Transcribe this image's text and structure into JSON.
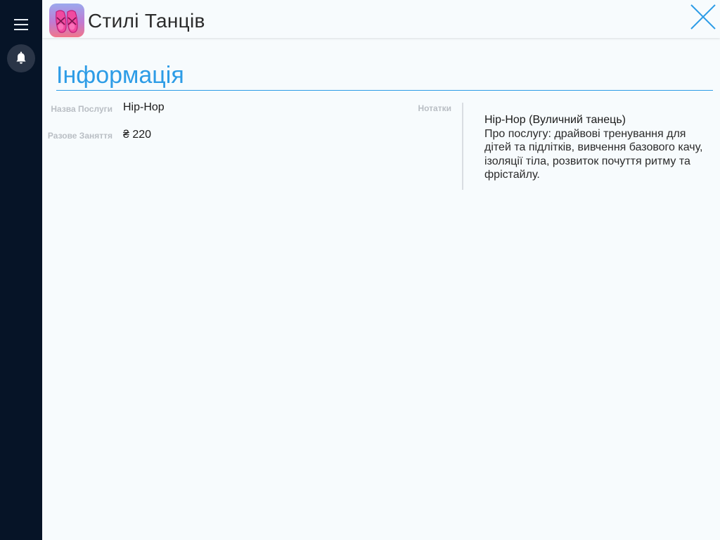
{
  "app": {
    "title": "Стилі Танців",
    "icon": "ballet-shoes-icon"
  },
  "sidebar": {
    "menu_icon": "hamburger-icon",
    "notifications_icon": "bell-icon"
  },
  "section": {
    "title": "Інформація"
  },
  "fields": {
    "service_name_label": "Назва Послуги",
    "service_name_value": "Hip-Hop",
    "single_class_label": "Разове Заняття",
    "single_class_value": "₴ 220",
    "notes_label": "Нотатки"
  },
  "notes": {
    "title": "Hip-Hop (Вуличний танець)",
    "body": "Про послугу: драйвові тренування для дітей та підлітків, вивчення базового качу, ізоляції тіла, розвиток почуття ритму та фрістайлу."
  },
  "colors": {
    "accent": "#2d9ce6",
    "sidebar": "#061427",
    "background": "#f7fbfd"
  }
}
